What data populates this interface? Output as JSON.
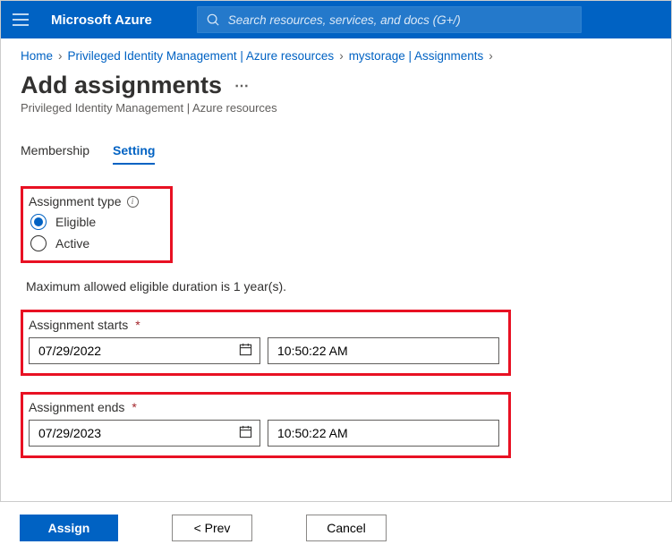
{
  "header": {
    "brand": "Microsoft Azure",
    "search_placeholder": "Search resources, services, and docs (G+/)"
  },
  "breadcrumb": {
    "items": [
      "Home",
      "Privileged Identity Management | Azure resources",
      "mystorage | Assignments"
    ]
  },
  "page": {
    "title": "Add assignments",
    "subtitle": "Privileged Identity Management | Azure resources"
  },
  "tabs": {
    "membership": "Membership",
    "setting": "Setting"
  },
  "assignment_type": {
    "label": "Assignment type",
    "eligible": "Eligible",
    "active": "Active",
    "selected": "eligible"
  },
  "duration_note": "Maximum allowed eligible duration is 1 year(s).",
  "starts": {
    "label": "Assignment starts",
    "date": "07/29/2022",
    "time": "10:50:22 AM"
  },
  "ends": {
    "label": "Assignment ends",
    "date": "07/29/2023",
    "time": "10:50:22 AM"
  },
  "footer": {
    "assign": "Assign",
    "prev": "<  Prev",
    "cancel": "Cancel"
  }
}
